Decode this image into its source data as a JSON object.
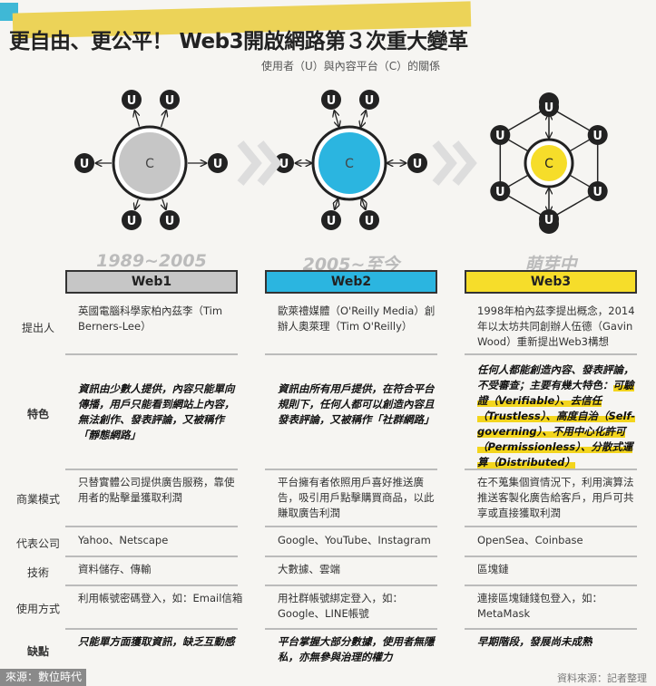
{
  "title": "更自由、更公平！ Web3開啟網路第３次重大變革",
  "subtitle": "使用者（U）與內容平台（C）的關係",
  "node_user": "U",
  "node_content": "C",
  "colors": {
    "web1": "#c6c6c6",
    "web2": "#2bb5e0",
    "web3": "#f6dd2a"
  },
  "columns": [
    {
      "era": "1989~2005",
      "name": "Web1"
    },
    {
      "era": "2005~至今",
      "name": "Web2"
    },
    {
      "era": "萌芽中",
      "name": "Web3"
    }
  ],
  "rows": [
    {
      "label": "提出人",
      "cells": [
        "英國電腦科學家柏內茲李（Tim Berners-Lee）",
        "歐萊禮媒體（O'Reilly Media）創辦人奧萊理（Tim O'Reilly）",
        "1998年柏內茲李提出概念，2014年以太坊共同創辦人伍德（Gavin Wood）重新提出Web3構想"
      ]
    },
    {
      "label": "特色",
      "cells": [
        "資訊由少數人提供，內容只能單向傳播，用戶只能看到網站上內容，無法創作、發表評論，又被稱作「靜態網路」",
        "資訊由所有用戶提供，在符合平台規則下，任何人都可以創造內容且發表評論，又被稱作「社群網路」",
        "任何人都能創造內容、發表評論，不受審查；主要有幾大特色："
      ],
      "web3_highlight": "可驗證（Verifiable）、去信任（Trustless）、高度自治（Self-governing）、不用中心化許可（Permissionless）、分散式運算（Distributed）"
    },
    {
      "label": "商業模式",
      "cells": [
        "只替實體公司提供廣告服務，靠使用者的點擊量獲取利潤",
        "平台擁有者依照用戶喜好推送廣告，吸引用戶點擊購買商品，以此賺取廣告利潤",
        "在不蒐集個資情況下，利用演算法推送客製化廣告給客戶，用戶可共享或直接獲取利潤"
      ]
    },
    {
      "label": "代表公司",
      "cells": [
        "Yahoo、Netscape",
        "Google、YouTube、Instagram",
        "OpenSea、Coinbase"
      ]
    },
    {
      "label": "技術",
      "cells": [
        "資料儲存、傳輸",
        "大數據、雲端",
        "區塊鏈"
      ]
    },
    {
      "label": "使用方式",
      "cells": [
        "利用帳號密碼登入，如：Email信箱",
        "用社群帳號綁定登入，如：Google、LINE帳號",
        "連接區塊鏈錢包登入，如：MetaMask"
      ]
    },
    {
      "label": "缺點",
      "cells": [
        "只能單方面獲取資訊，缺乏互動感",
        "平台掌握大部分數據，使用者無隱私，亦無參與治理的權力",
        "早期階段，發展尚未成熟"
      ]
    }
  ],
  "source_left": "來源：數位時代",
  "source_right": "資料來源：記者整理"
}
